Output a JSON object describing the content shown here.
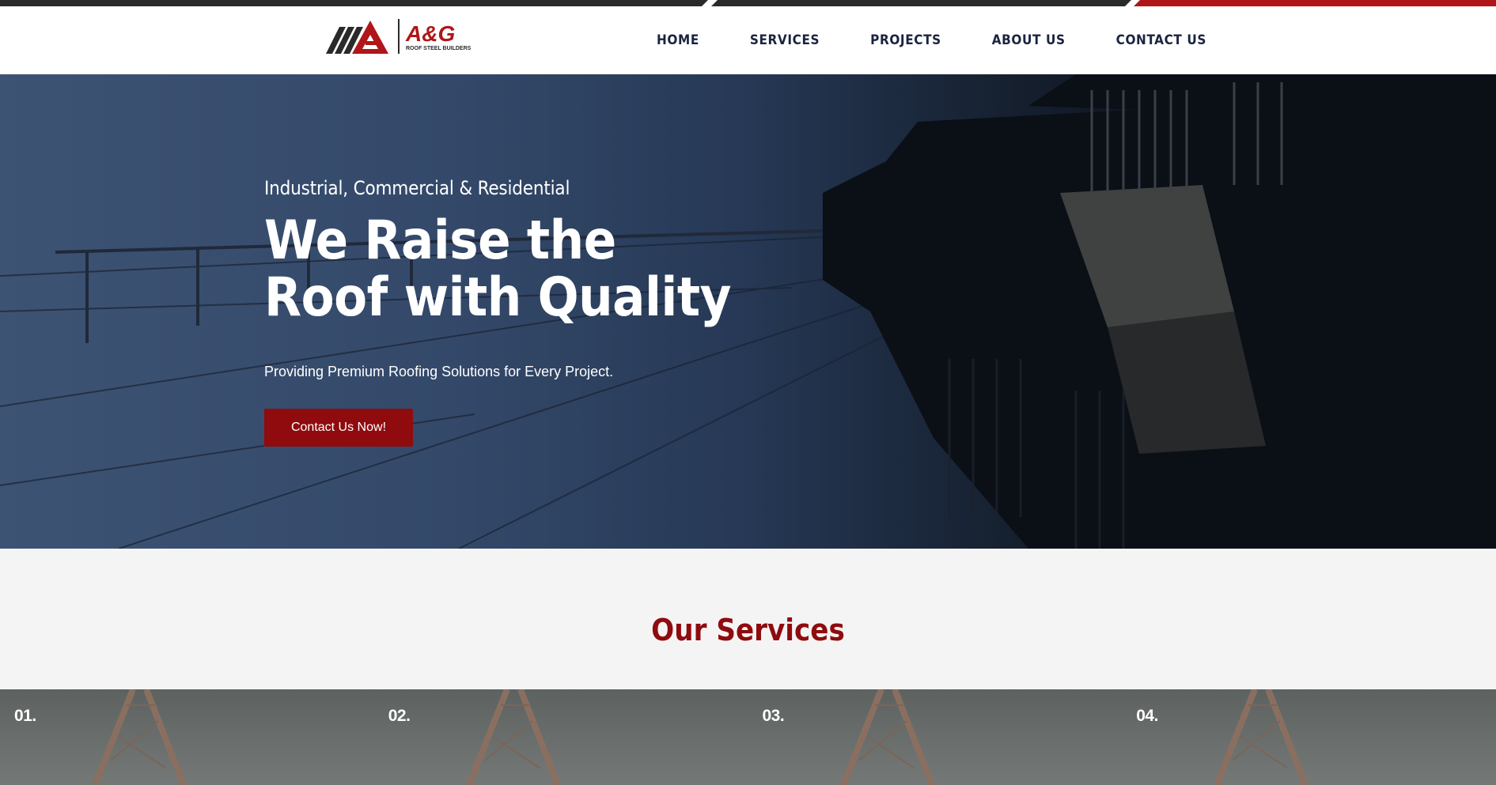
{
  "brand": {
    "logo_text": "A&G",
    "logo_tagline": "ROOF STEEL BUILDERS",
    "colors": {
      "primary": "#8f0b0e",
      "dark": "#1b2440",
      "stripe": "#2a2a2a"
    }
  },
  "nav": {
    "items": [
      {
        "label": "HOME"
      },
      {
        "label": "SERVICES"
      },
      {
        "label": "PROJECTS"
      },
      {
        "label": "ABOUT US"
      },
      {
        "label": "CONTACT US"
      }
    ]
  },
  "hero": {
    "subtitle": "Industrial, Commercial & Residential",
    "title": "We Raise the Roof with Quality",
    "description": "Providing Premium Roofing Solutions for Every Project.",
    "cta_label": "Contact Us Now!"
  },
  "services": {
    "title": "Our Services",
    "cards": [
      {
        "number": "01."
      },
      {
        "number": "02."
      },
      {
        "number": "03."
      },
      {
        "number": "04."
      }
    ]
  }
}
